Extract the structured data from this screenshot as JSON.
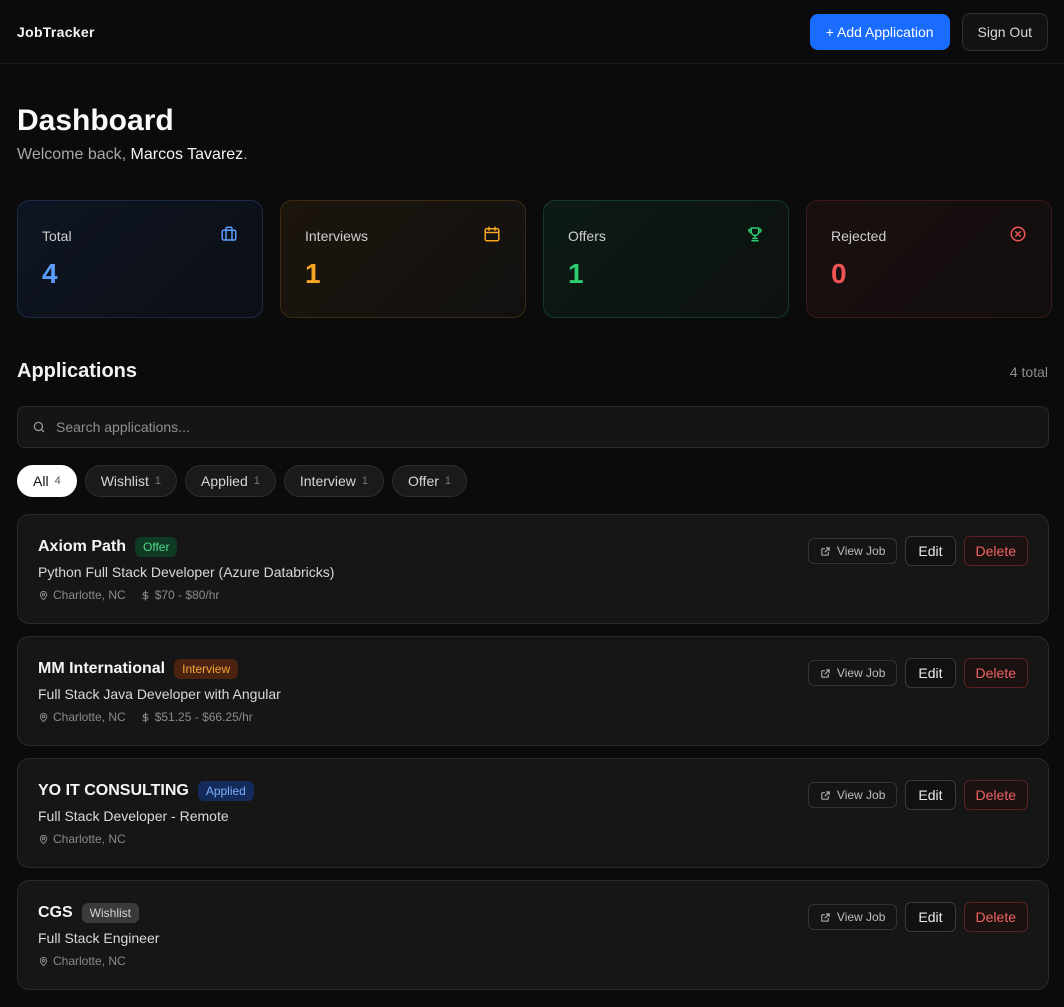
{
  "header": {
    "brand": "JobTracker",
    "add_label": "+ Add Application",
    "signout_label": "Sign Out"
  },
  "page": {
    "title": "Dashboard",
    "welcome_prefix": "Welcome back, ",
    "user_name": "Marcos Tavarez",
    "welcome_suffix": "."
  },
  "stats": [
    {
      "label": "Total",
      "value": "4",
      "icon": "briefcase-icon",
      "color": "#5b9cff"
    },
    {
      "label": "Interviews",
      "value": "1",
      "icon": "calendar-icon",
      "color": "#f5a623"
    },
    {
      "label": "Offers",
      "value": "1",
      "icon": "trophy-icon",
      "color": "#2ecc71"
    },
    {
      "label": "Rejected",
      "value": "0",
      "icon": "x-circle-icon",
      "color": "#f05454"
    }
  ],
  "applications": {
    "title": "Applications",
    "count_label": "4 total",
    "search_placeholder": "Search applications...",
    "filters": [
      {
        "label": "All",
        "count": "4",
        "active": true
      },
      {
        "label": "Wishlist",
        "count": "1"
      },
      {
        "label": "Applied",
        "count": "1"
      },
      {
        "label": "Interview",
        "count": "1"
      },
      {
        "label": "Offer",
        "count": "1"
      }
    ],
    "items": [
      {
        "company": "Axiom Path",
        "status": "Offer",
        "role": "Python Full Stack Developer (Azure Databricks)",
        "location": "Charlotte, NC",
        "pay": "$70 - $80/hr"
      },
      {
        "company": "MM International",
        "status": "Interview",
        "role": "Full Stack Java Developer with Angular",
        "location": "Charlotte, NC",
        "pay": "$51.25 - $66.25/hr"
      },
      {
        "company": "YO IT CONSULTING",
        "status": "Applied",
        "role": "Full Stack Developer - Remote",
        "location": "Charlotte, NC",
        "pay": ""
      },
      {
        "company": "CGS",
        "status": "Wishlist",
        "role": "Full Stack Engineer",
        "location": "Charlotte, NC",
        "pay": ""
      }
    ],
    "actions": {
      "view": "View Job",
      "edit": "Edit",
      "delete": "Delete"
    }
  },
  "colors": {
    "accent": "#1a6cff",
    "background": "#0b0b0b"
  }
}
